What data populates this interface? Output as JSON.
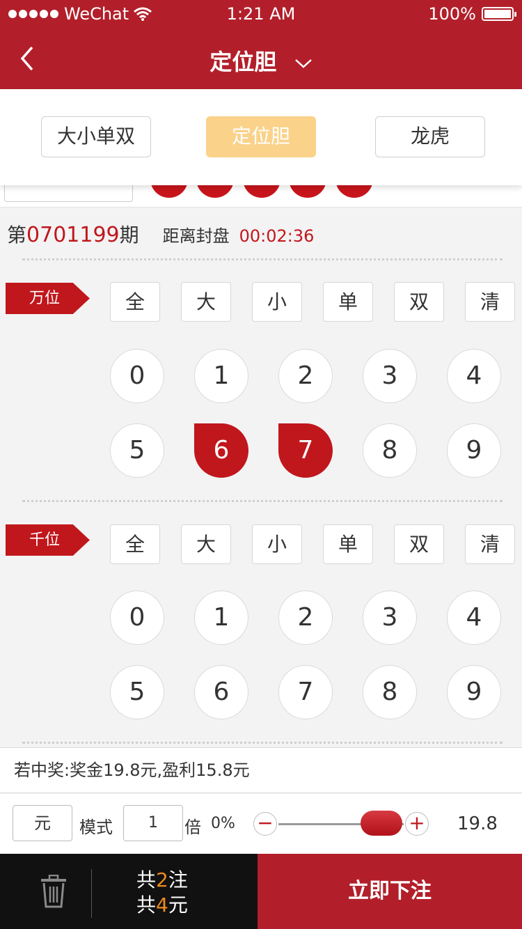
{
  "status": {
    "carrier": "WeChat",
    "time": "1:21 AM",
    "battery": "100%"
  },
  "nav": {
    "title": "定位胆"
  },
  "tabs": [
    {
      "label": "大小单双",
      "active": false
    },
    {
      "label": "定位胆",
      "active": true
    },
    {
      "label": "龙虎",
      "active": false
    }
  ],
  "issue": {
    "prefix": "第",
    "number": "0701199",
    "suffix": "期",
    "close_label": "距离封盘",
    "countdown": "00:02:36"
  },
  "sections": [
    {
      "label": "万位",
      "quick": [
        "全",
        "大",
        "小",
        "单",
        "双",
        "清"
      ],
      "numbers": [
        "0",
        "1",
        "2",
        "3",
        "4",
        "5",
        "6",
        "7",
        "8",
        "9"
      ],
      "selected": [
        "6",
        "7"
      ]
    },
    {
      "label": "千位",
      "quick": [
        "全",
        "大",
        "小",
        "单",
        "双",
        "清"
      ],
      "numbers": [
        "0",
        "1",
        "2",
        "3",
        "4",
        "5",
        "6",
        "7",
        "8",
        "9"
      ],
      "selected": []
    }
  ],
  "prize": {
    "text": "若中奖:奖金19.8元,盈利15.8元"
  },
  "controls": {
    "unit": "元",
    "mode_label": "模式",
    "multiplier": "1",
    "bei_label": "倍",
    "rebate": "0%",
    "slider_level": 1.0,
    "amount": "19.8"
  },
  "footer": {
    "total_prefix": "共",
    "bets": "2",
    "bets_unit": "注",
    "cost": "4",
    "cost_unit": "元",
    "submit": "立即下注"
  },
  "colors": {
    "brand": "#b21f2a",
    "accent": "#c0171d",
    "tab_active": "#fad28a",
    "highlight": "#f08a1c"
  }
}
